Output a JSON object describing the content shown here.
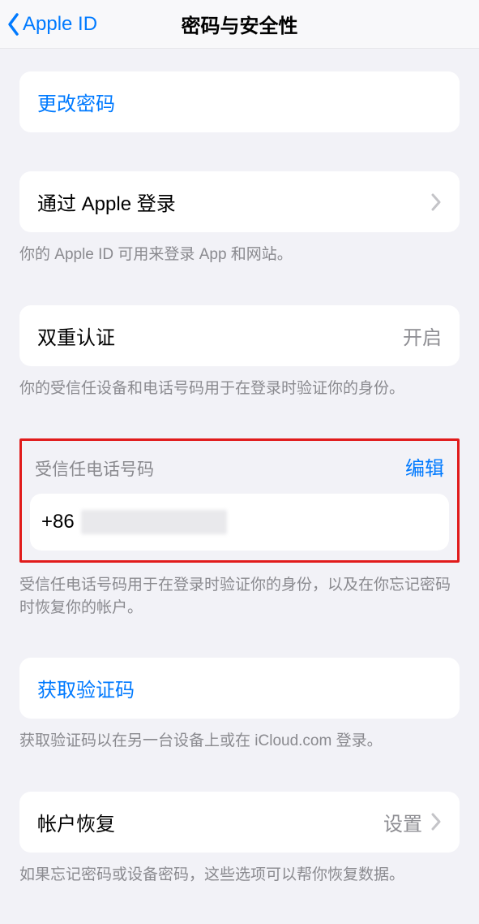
{
  "nav": {
    "back_label": "Apple ID",
    "title": "密码与安全性"
  },
  "change_password": {
    "label": "更改密码"
  },
  "sign_in_with_apple": {
    "label": "通过 Apple 登录",
    "footer": "你的 Apple ID 可用来登录 App 和网站。"
  },
  "two_factor": {
    "label": "双重认证",
    "value": "开启",
    "footer": "你的受信任设备和电话号码用于在登录时验证你的身份。"
  },
  "trusted_number": {
    "header": "受信任电话号码",
    "edit": "编辑",
    "prefix": "+86",
    "footer": "受信任电话号码用于在登录时验证你的身份，以及在你忘记密码时恢复你的帐户。"
  },
  "get_code": {
    "label": "获取验证码",
    "footer": "获取验证码以在另一台设备上或在 iCloud.com 登录。"
  },
  "account_recovery": {
    "label": "帐户恢复",
    "value": "设置",
    "footer": "如果忘记密码或设备密码，这些选项可以帮你恢复数据。"
  }
}
